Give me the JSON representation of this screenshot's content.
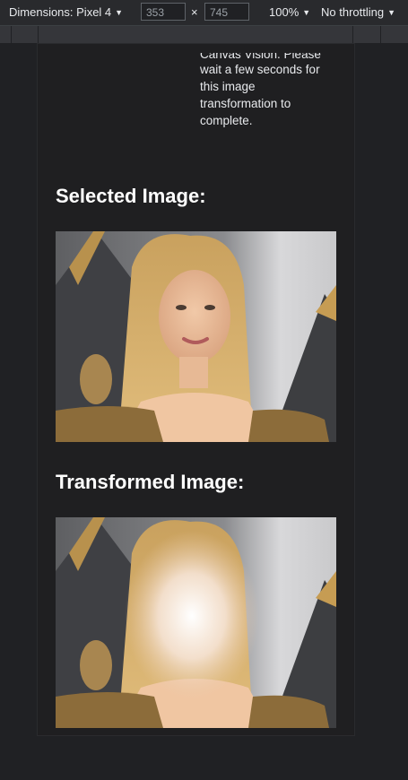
{
  "devtools": {
    "dimensions_label": "Dimensions: Pixel 4",
    "width_value": "353",
    "height_value": "745",
    "times_symbol": "×",
    "zoom_label": "100%",
    "throttle_label": "No throttling"
  },
  "page": {
    "description_lines": [
      "Canvas Vision. Please",
      "wait a few seconds for",
      "this image",
      "transformation to",
      "complete."
    ],
    "selected_heading": "Selected Image:",
    "transformed_heading": "Transformed Image:"
  },
  "icons": [
    "caret-down-icon"
  ]
}
